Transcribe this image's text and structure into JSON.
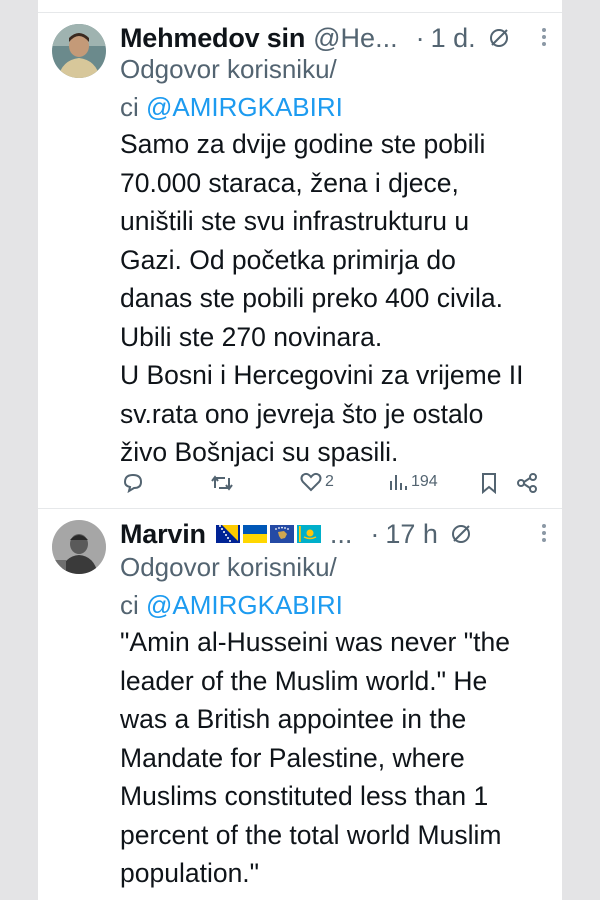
{
  "tweets": [
    {
      "author": "Mehmedov sin",
      "handle": "@He...",
      "time": "1 d.",
      "reply_prefix": "Odgovor korisniku/",
      "reply_ci": "ci ",
      "reply_mention": "@AMIRGKABIRI",
      "lines": [
        "Samo za dvije godine ste pobili",
        "70.000 staraca, žena i djece,",
        "uništili ste svu infrastrukturu u",
        "Gazi. Od početka primirja do",
        "danas ste pobili preko 400 civila.",
        "Ubili ste 270 novinara.",
        "U Bosni i Hercegovini za vrijeme II",
        "sv.rata ono jevreja što je ostalo",
        "živo Bošnjaci su spasili."
      ],
      "likes": "2",
      "views": "194"
    },
    {
      "author": "Marvin",
      "ellipsis": "...",
      "time": "17 h",
      "reply_prefix": "Odgovor korisniku/",
      "reply_ci": "ci ",
      "reply_mention": "@AMIRGKABIRI",
      "lines": [
        "\"Amin al-Husseini was never \"the",
        "leader of the Muslim world.\" He",
        "was a British appointee in the",
        "Mandate for Palestine, where",
        "Muslims constituted less than 1",
        "percent of the total world Muslim",
        "population.\""
      ]
    }
  ],
  "separator_dot": "·",
  "colors": {
    "mention": "#1d9bf0",
    "secondary": "#536471",
    "text": "#0f1419"
  },
  "icons": [
    "edit-icon",
    "more-icon",
    "reply-icon",
    "retweet-icon",
    "like-icon",
    "views-icon",
    "bookmark-icon",
    "share-icon"
  ]
}
